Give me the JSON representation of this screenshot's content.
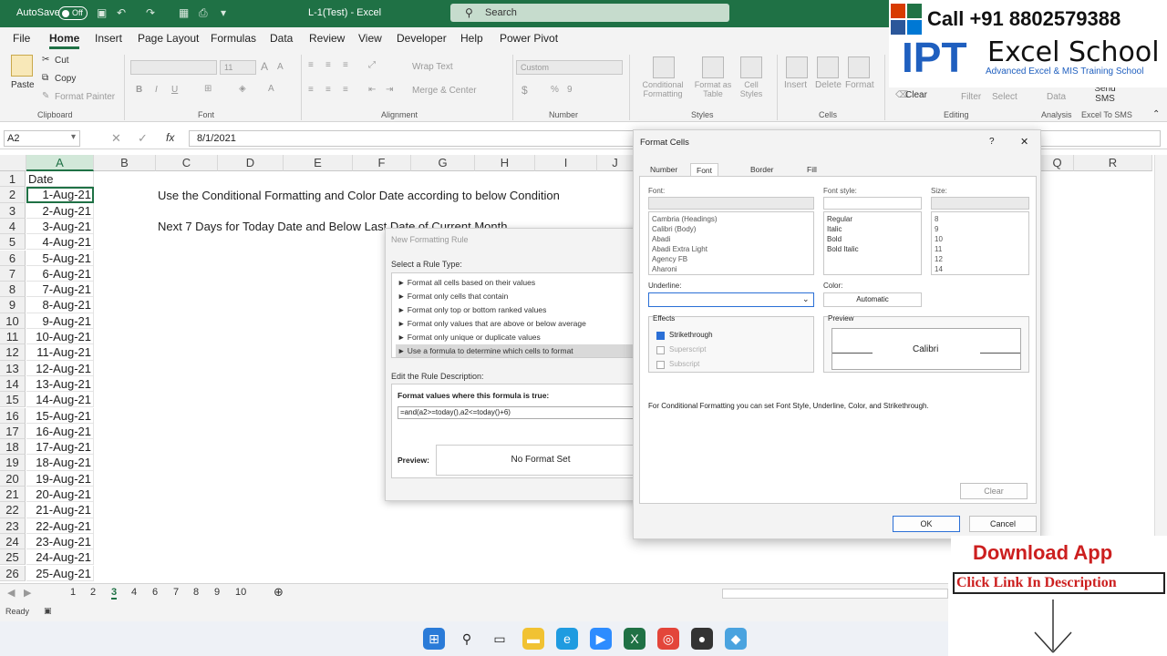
{
  "titlebar": {
    "autosave_label": "AutoSave",
    "autosave_state": "Off",
    "doc_title": "L-1(Test)  -  Excel",
    "search_placeholder": "Search"
  },
  "menu": [
    "File",
    "Home",
    "Insert",
    "Page Layout",
    "Formulas",
    "Data",
    "Review",
    "View",
    "Developer",
    "Help",
    "Power Pivot"
  ],
  "ribbon": {
    "clipboard": {
      "paste": "Paste",
      "cut": "Cut",
      "copy": "Copy",
      "format_painter": "Format Painter",
      "label": "Clipboard"
    },
    "font": {
      "label": "Font",
      "size": "11"
    },
    "alignment": {
      "wrap": "Wrap Text",
      "merge": "Merge & Center",
      "label": "Alignment"
    },
    "number": {
      "format": "Custom",
      "label": "Number"
    },
    "styles": {
      "cond": "Conditional Formatting",
      "table": "Format as Table",
      "cell": "Cell Styles",
      "label": "Styles"
    },
    "cells": {
      "insert": "Insert",
      "delete": "Delete",
      "format": "Format",
      "label": "Cells"
    },
    "editing": {
      "clear": "Clear",
      "filter": "Filter",
      "select": "Select",
      "label": "Editing"
    },
    "analysis": {
      "analyze": "Data",
      "label": "Analysis"
    },
    "sms": {
      "send": "Send SMS",
      "label": "Excel To SMS"
    }
  },
  "formula_bar": {
    "name_box": "A2",
    "value": "8/1/2021"
  },
  "columns": [
    "A",
    "B",
    "C",
    "D",
    "E",
    "F",
    "G",
    "H",
    "I",
    "J",
    "Q",
    "R"
  ],
  "rows": [
    "1",
    "2",
    "3",
    "4",
    "5",
    "6",
    "7",
    "8",
    "9",
    "10",
    "11",
    "12",
    "13",
    "14",
    "15",
    "16",
    "17",
    "18",
    "19",
    "20",
    "21",
    "22",
    "23",
    "24",
    "25",
    "26"
  ],
  "cells_a": [
    "Date",
    "1-Aug-21",
    "2-Aug-21",
    "3-Aug-21",
    "4-Aug-21",
    "5-Aug-21",
    "6-Aug-21",
    "7-Aug-21",
    "8-Aug-21",
    "9-Aug-21",
    "10-Aug-21",
    "11-Aug-21",
    "12-Aug-21",
    "13-Aug-21",
    "14-Aug-21",
    "15-Aug-21",
    "16-Aug-21",
    "17-Aug-21",
    "18-Aug-21",
    "19-Aug-21",
    "20-Aug-21",
    "21-Aug-21",
    "22-Aug-21",
    "23-Aug-21",
    "24-Aug-21",
    "25-Aug-21"
  ],
  "sheet_text": {
    "c2": "Use the Conditional Formatting and Color Date according to below Condition",
    "c4": "Next 7 Days for Today Date and Below Last Date of Current Month"
  },
  "sheet_tabs": [
    "1",
    "2",
    "3",
    "4",
    "6",
    "7",
    "8",
    "9",
    "10"
  ],
  "active_sheet": "3",
  "status": "Ready",
  "new_rule_dialog": {
    "title": "New Formatting Rule",
    "select_label": "Select a Rule Type:",
    "rules": [
      "► Format all cells based on their values",
      "► Format only cells that contain",
      "► Format only top or bottom ranked values",
      "► Format only values that are above or below average",
      "► Format only unique or duplicate values",
      "► Use a formula to determine which cells to format"
    ],
    "edit_label": "Edit the Rule Description:",
    "formula_label": "Format values where this formula is true:",
    "formula": "=and(a2>=today(),a2<=today()+6)",
    "preview_label": "Preview:",
    "preview_text": "No Format Set"
  },
  "format_cells_dialog": {
    "title": "Format Cells",
    "help": "?",
    "close": "✕",
    "tabs": [
      "Number",
      "Font",
      "Border",
      "Fill"
    ],
    "font_label": "Font:",
    "fonts": [
      "Cambria (Headings)",
      "Calibri (Body)",
      "Abadi",
      "Abadi Extra Light",
      "Agency FB",
      "Aharoni"
    ],
    "style_label": "Font style:",
    "styles": [
      "Regular",
      "Italic",
      "Bold",
      "Bold Italic"
    ],
    "size_label": "Size:",
    "sizes": [
      "8",
      "9",
      "10",
      "11",
      "12",
      "14"
    ],
    "underline_label": "Underline:",
    "color_label": "Color:",
    "color_value": "Automatic",
    "effects_label": "Effects",
    "strike": "Strikethrough",
    "super": "Superscript",
    "sub": "Subscript",
    "preview_label": "Preview",
    "preview_sample": "Calibri",
    "note": "For Conditional Formatting you can set Font Style, Underline, Color, and Strikethrough.",
    "clear": "Clear",
    "ok": "OK",
    "cancel": "Cancel"
  },
  "overlay": {
    "phone": "Call +91 8802579388",
    "logo_left": "IPT",
    "logo_right": "Excel School",
    "tagline": "Advanced Excel & MIS Training School",
    "download": "Download App",
    "click": "Click Link In Description"
  },
  "colors": {
    "excel_green": "#1f7145",
    "brand_red": "#cc1f1f",
    "brand_blue": "#1f5fbf"
  }
}
